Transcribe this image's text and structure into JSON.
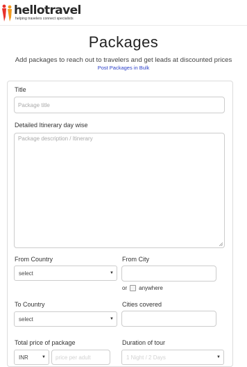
{
  "brand": {
    "name": "hellotravel",
    "tagline": "helping travelers connect specialists",
    "colors": {
      "accent": "#e8322b",
      "link": "#2b3fc9"
    }
  },
  "header": {
    "title": "Packages",
    "subtitle": "Add packages to reach out to travelers and get leads at discounted prices",
    "bulk_link": "Post Packages in Bulk"
  },
  "form": {
    "title": {
      "label": "Title",
      "placeholder": "Package title"
    },
    "itinerary": {
      "label": "Detailed Itinerary day wise",
      "placeholder": "Package description / Itinerary"
    },
    "from_country": {
      "label": "From Country",
      "value": "select"
    },
    "from_city": {
      "label": "From City",
      "value": ""
    },
    "anywhere": {
      "or": "or",
      "label": "anywhere"
    },
    "to_country": {
      "label": "To Country",
      "value": "select"
    },
    "cities_covered": {
      "label": "Cities covered",
      "value": ""
    },
    "price": {
      "label": "Total price of package",
      "currency": "INR",
      "placeholder": "price per adult"
    },
    "duration": {
      "label": "Duration of tour",
      "value": "1 Night / 2 Days"
    }
  }
}
